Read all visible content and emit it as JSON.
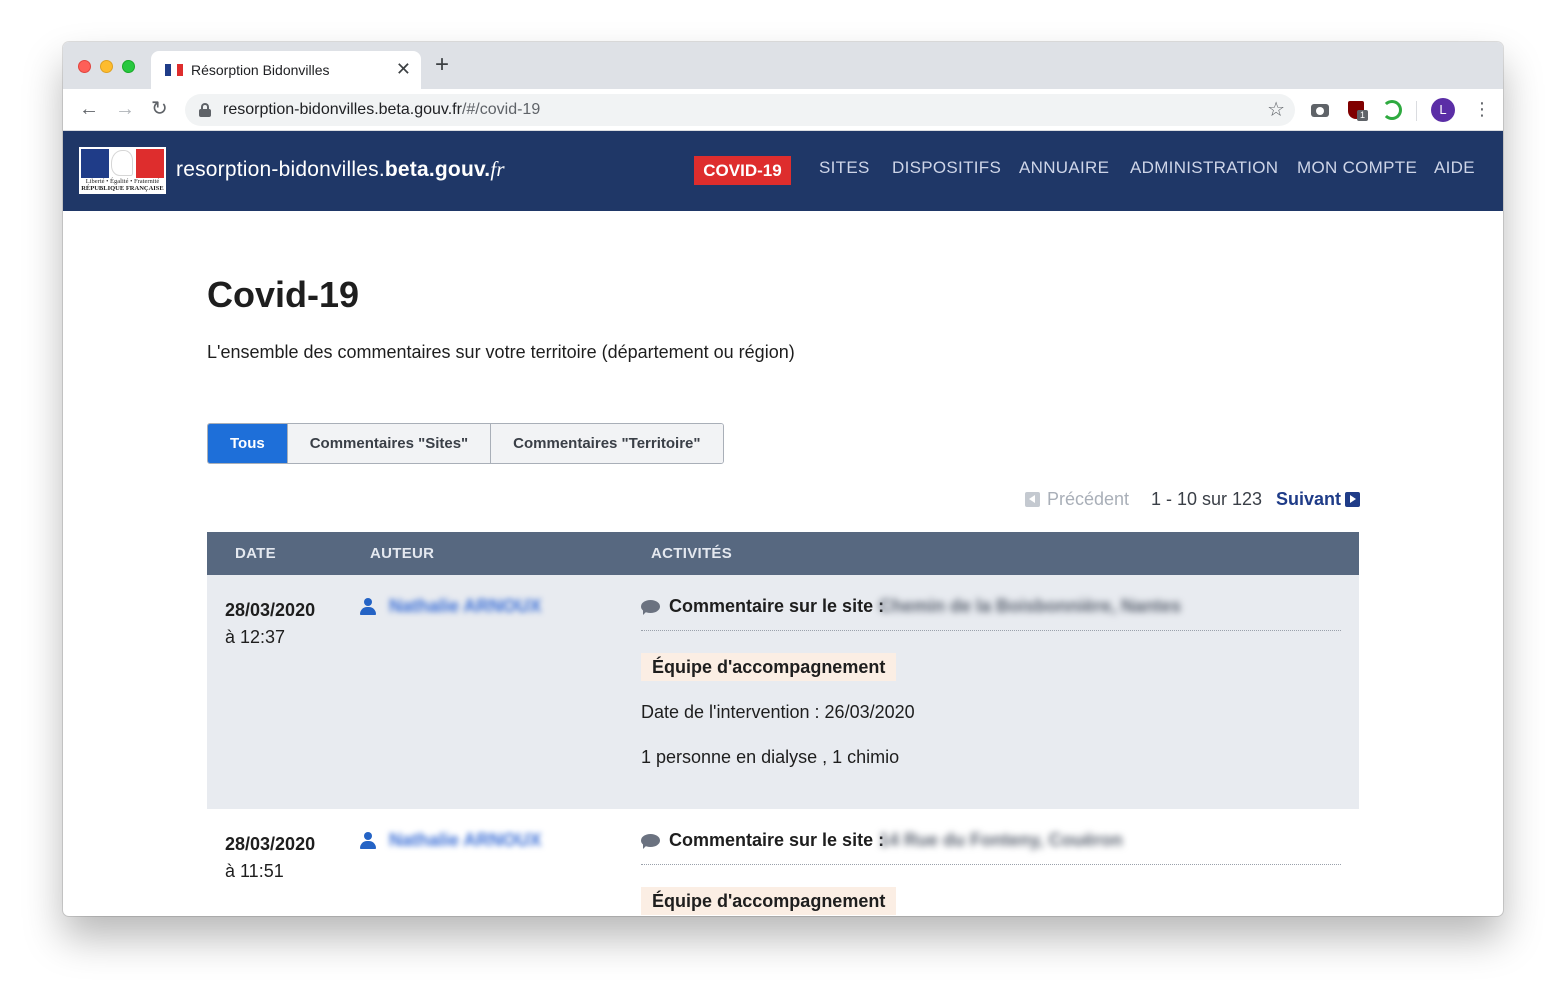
{
  "browser": {
    "tab_title": "Résorption Bidonvilles",
    "tab_close": "✕",
    "new_tab": "+",
    "url_host": "resorption-bidonvilles.beta.gouv.fr",
    "url_path": "/#/covid-19",
    "back": "←",
    "forward": "→",
    "reload": "↻",
    "star": "☆",
    "ublock_badge": "1",
    "avatar_letter": "L",
    "menu": "⋮"
  },
  "header": {
    "logo_text_line1": "Liberté • Égalité • Fraternité",
    "logo_text_line2": "RÉPUBLIQUE FRANÇAISE",
    "brand_main": "resorption-bidonvilles.",
    "brand_bold": "beta.gouv.",
    "brand_fr": "fr",
    "nav": {
      "active": "COVID-19",
      "sites": "SITES",
      "dispositifs": "DISPOSITIFS",
      "annuaire": "ANNUAIRE",
      "administration": "ADMINISTRATION",
      "mon_compte": "MON COMPTE",
      "aide": "AIDE"
    },
    "colors": {
      "navy": "#1f3767",
      "active_red": "#de2d2d"
    }
  },
  "page": {
    "title": "Covid-19",
    "subtitle": "L'ensemble des commentaires sur votre territoire (département ou région)"
  },
  "filters": {
    "all": "Tous",
    "sites": "Commentaires \"Sites\"",
    "territoire": "Commentaires \"Territoire\"",
    "selected": "Tous"
  },
  "pagination": {
    "previous": "Précédent",
    "range": "1 - 10 sur 123",
    "next": "Suivant"
  },
  "table": {
    "headers": {
      "date": "DATE",
      "author": "AUTEUR",
      "activities": "ACTIVITÉS"
    },
    "rows": [
      {
        "date": "28/03/2020",
        "time": "à 12:37",
        "author": "Nathalie ARNOUX",
        "comment_label": "Commentaire sur le site :",
        "site": "Chemin de la Boisbonnière, Nantes",
        "tag": "Équipe d'accompagnement",
        "line1": "Date de l'intervention : 26/03/2020",
        "line2": "1 personne en dialyse , 1 chimio"
      },
      {
        "date": "28/03/2020",
        "time": "à 11:51",
        "author": "Nathalie ARNOUX",
        "comment_label": "Commentaire sur le site :",
        "site": "14 Rue du Fonteny, Couëron",
        "tag": "Équipe d'accompagnement"
      }
    ]
  }
}
